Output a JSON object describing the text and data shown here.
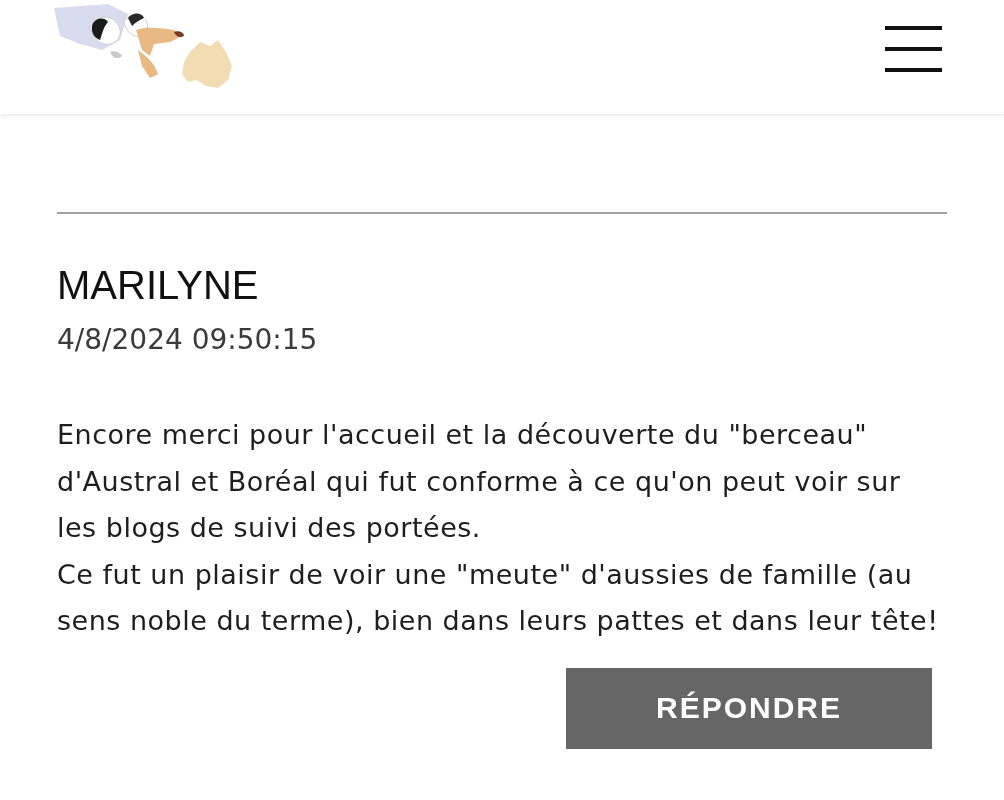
{
  "comment": {
    "author": "MARILYNE",
    "date": "4/8/2024 09:50:15",
    "message": [
      "Encore merci pour l'accueil et la découverte du \"berceau\" d'Austral et Boréal qui fut conforme à ce qu'on peut voir sur les blogs de suivi des portées.",
      "Ce fut un plaisir de voir une \"meute\" d'aussies de famille (au sens noble du terme), bien dans leurs pattes et dans leur tête!"
    ],
    "reply_button": "RÉPONDRE"
  }
}
